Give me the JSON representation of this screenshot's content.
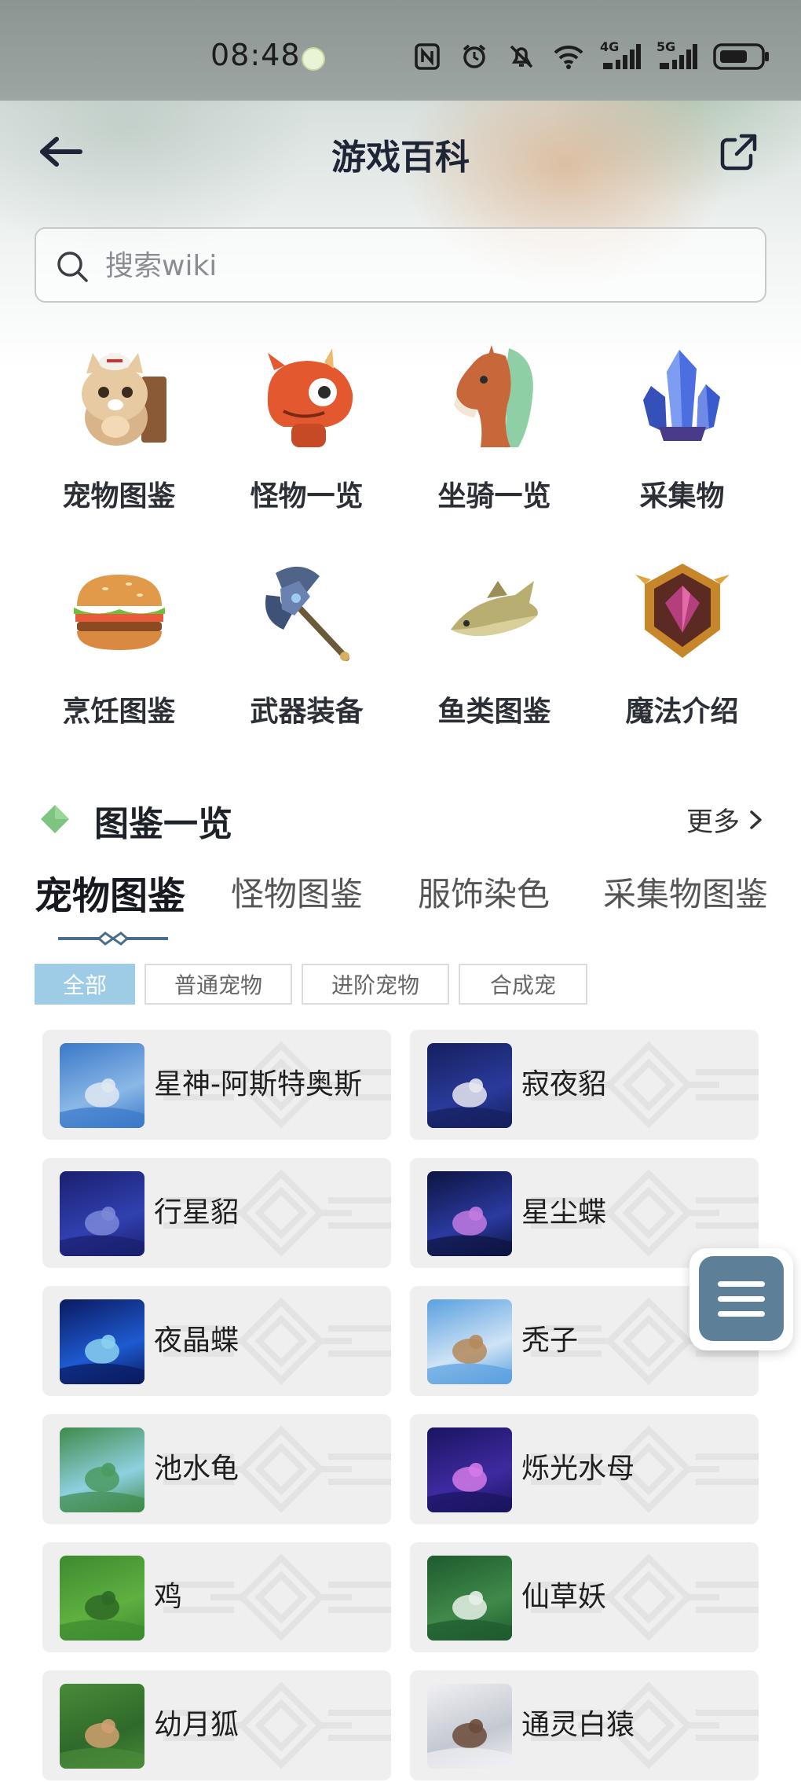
{
  "status_bar": {
    "time": "08:48",
    "icons": [
      "nfc-icon",
      "alarm-icon",
      "mute-icon",
      "wifi-icon",
      "signal-4g-icon",
      "signal-5g-icon",
      "battery-icon"
    ],
    "network_4g": "4G",
    "network_5g": "5G"
  },
  "header": {
    "title": "游戏百科",
    "back_icon": "back-arrow-icon",
    "share_icon": "share-icon"
  },
  "search": {
    "placeholder": "搜索wiki",
    "value": ""
  },
  "categories": [
    {
      "label": "宠物图鉴",
      "icon": "pet-guide-icon"
    },
    {
      "label": "怪物一览",
      "icon": "monster-icon"
    },
    {
      "label": "坐骑一览",
      "icon": "mount-icon"
    },
    {
      "label": "采集物",
      "icon": "crystal-icon"
    },
    {
      "label": "烹饪图鉴",
      "icon": "burger-icon"
    },
    {
      "label": "武器装备",
      "icon": "axe-icon"
    },
    {
      "label": "鱼类图鉴",
      "icon": "fish-icon"
    },
    {
      "label": "魔法介绍",
      "icon": "magic-badge-icon"
    }
  ],
  "section": {
    "title": "图鉴一览",
    "more_label": "更多"
  },
  "tabs": [
    {
      "label": "宠物图鉴",
      "active": true
    },
    {
      "label": "怪物图鉴",
      "active": false
    },
    {
      "label": "服饰染色",
      "active": false
    },
    {
      "label": "采集物图鉴",
      "active": false
    }
  ],
  "filters": [
    {
      "label": "全部",
      "active": true
    },
    {
      "label": "普通宠物",
      "active": false
    },
    {
      "label": "进阶宠物",
      "active": false
    },
    {
      "label": "合成宠",
      "active": false
    }
  ],
  "colors": {
    "accent_chip": "#9ecbe6",
    "section_diamond": "#7cc47f",
    "float_menu": "#5d7f98",
    "card_bg": "#efefef"
  },
  "pets": [
    {
      "name": "星神-阿斯特奥斯"
    },
    {
      "name": "寂夜貂"
    },
    {
      "name": "行星貂"
    },
    {
      "name": "星尘蝶"
    },
    {
      "name": "夜晶蝶"
    },
    {
      "name": "秃子"
    },
    {
      "name": "池水龟"
    },
    {
      "name": "烁光水母"
    },
    {
      "name": "鸡"
    },
    {
      "name": "仙草妖"
    },
    {
      "name": "幼月狐"
    },
    {
      "name": "通灵白猿"
    }
  ],
  "float_menu": {
    "icon": "menu-icon"
  }
}
